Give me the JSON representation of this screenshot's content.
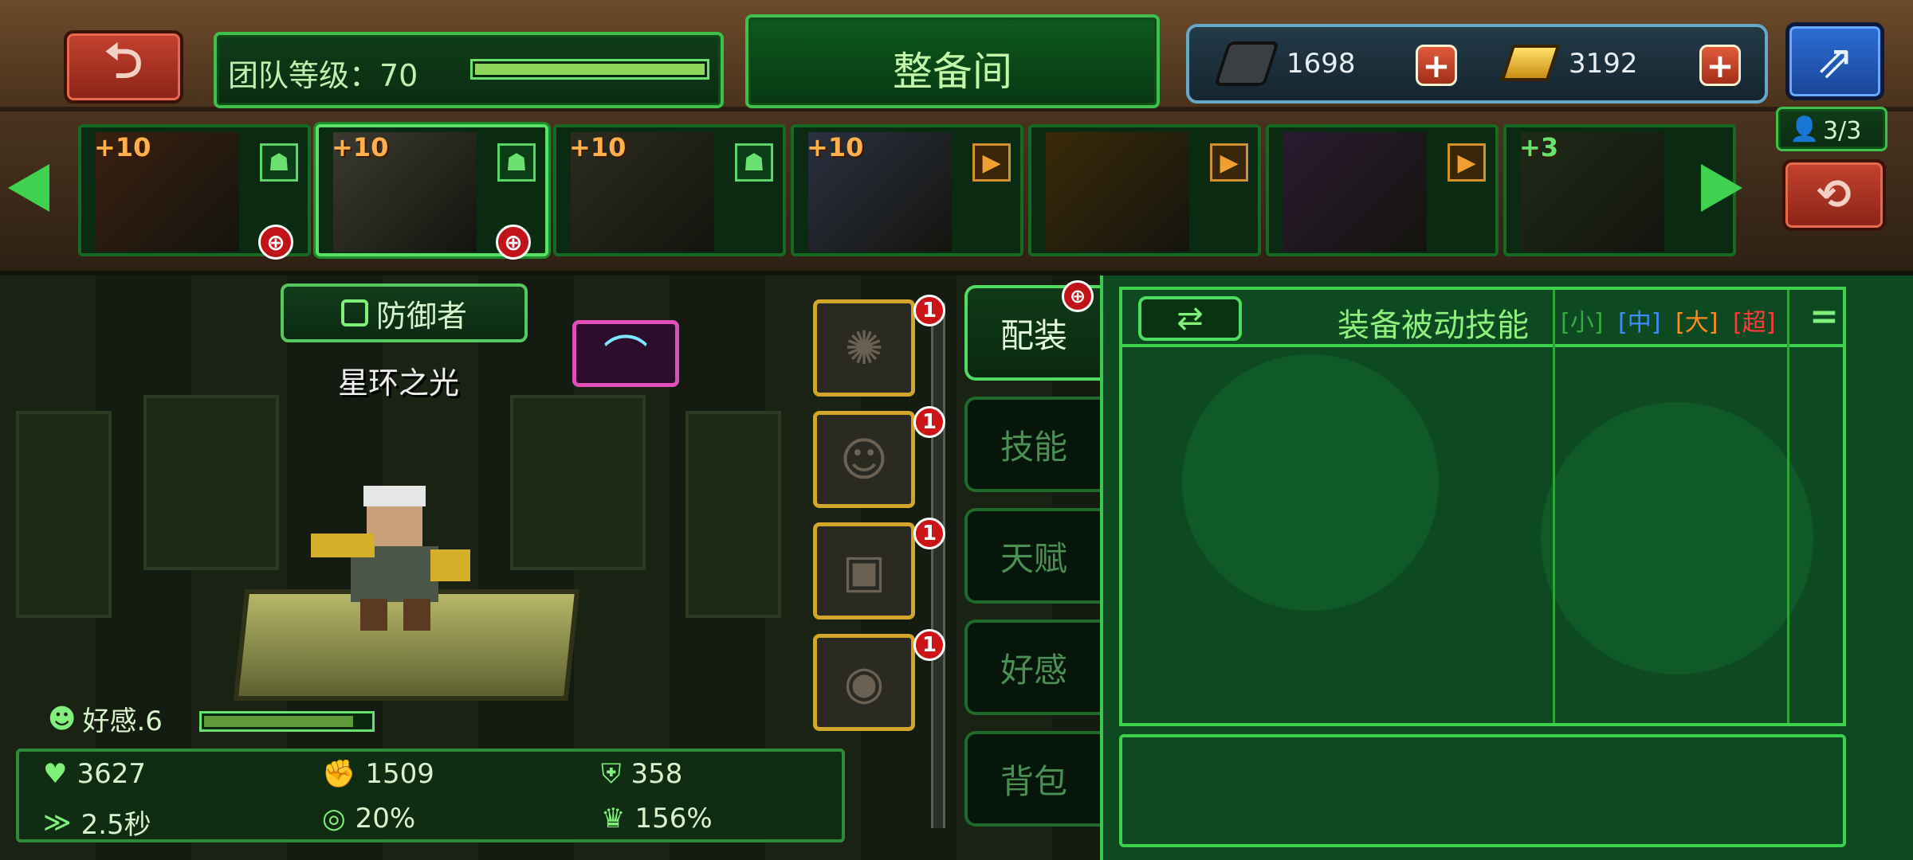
{
  "header": {
    "team_level_label": "团队等级：70",
    "team_level_progress": 1.0,
    "screen_title": "整备间",
    "currencies": [
      {
        "name": "silver-chip",
        "value": "1698"
      },
      {
        "name": "gold-bar",
        "value": "3192"
      }
    ],
    "squad_count": "3/3"
  },
  "roster": [
    {
      "level": "+10",
      "tag": "person",
      "marked": true
    },
    {
      "level": "+10",
      "tag": "person",
      "marked": true,
      "selected": true
    },
    {
      "level": "+10",
      "tag": "person",
      "marked": false
    },
    {
      "level": "+10",
      "tag": "arrow",
      "marked": false
    },
    {
      "level": "",
      "tag": "arrow",
      "marked": false
    },
    {
      "level": "",
      "tag": "arrow",
      "marked": false
    },
    {
      "level": "+3",
      "tag": "",
      "marked": false
    }
  ],
  "hero": {
    "role": "防御者",
    "name": "星环之光",
    "affection_label": "好感.6",
    "affection_progress": 0.9,
    "stats": [
      {
        "icon": "heart-icon",
        "value": "3627"
      },
      {
        "icon": "attack-icon",
        "value": "1509"
      },
      {
        "icon": "defense-icon",
        "value": "358"
      },
      {
        "icon": "speed-icon",
        "value": "2.5秒"
      },
      {
        "icon": "crit-icon",
        "value": "20%"
      },
      {
        "icon": "crit-damage-icon",
        "value": "156%"
      }
    ]
  },
  "gear_slots": [
    {
      "icon": "weapon-icon",
      "badge": "1"
    },
    {
      "icon": "helmet-icon",
      "badge": "1"
    },
    {
      "icon": "armor-icon",
      "badge": "1"
    },
    {
      "icon": "accessory-icon",
      "badge": "1"
    }
  ],
  "tabs": [
    "配装",
    "技能",
    "天赋",
    "好感",
    "背包"
  ],
  "passive_panel": {
    "title": "装备被动技能",
    "sizes": [
      {
        "label": "[小]",
        "color": "#38a843"
      },
      {
        "label": "[中]",
        "color": "#3f8bff"
      },
      {
        "label": "[大]",
        "color": "#ff8a1e"
      },
      {
        "label": "[超]",
        "color": "#ff3a3a"
      }
    ],
    "menu_symbol": "="
  },
  "colors": {
    "accent_green": "#3cd14e",
    "gold": "#d1a62b",
    "alert_red": "#cc1318"
  }
}
